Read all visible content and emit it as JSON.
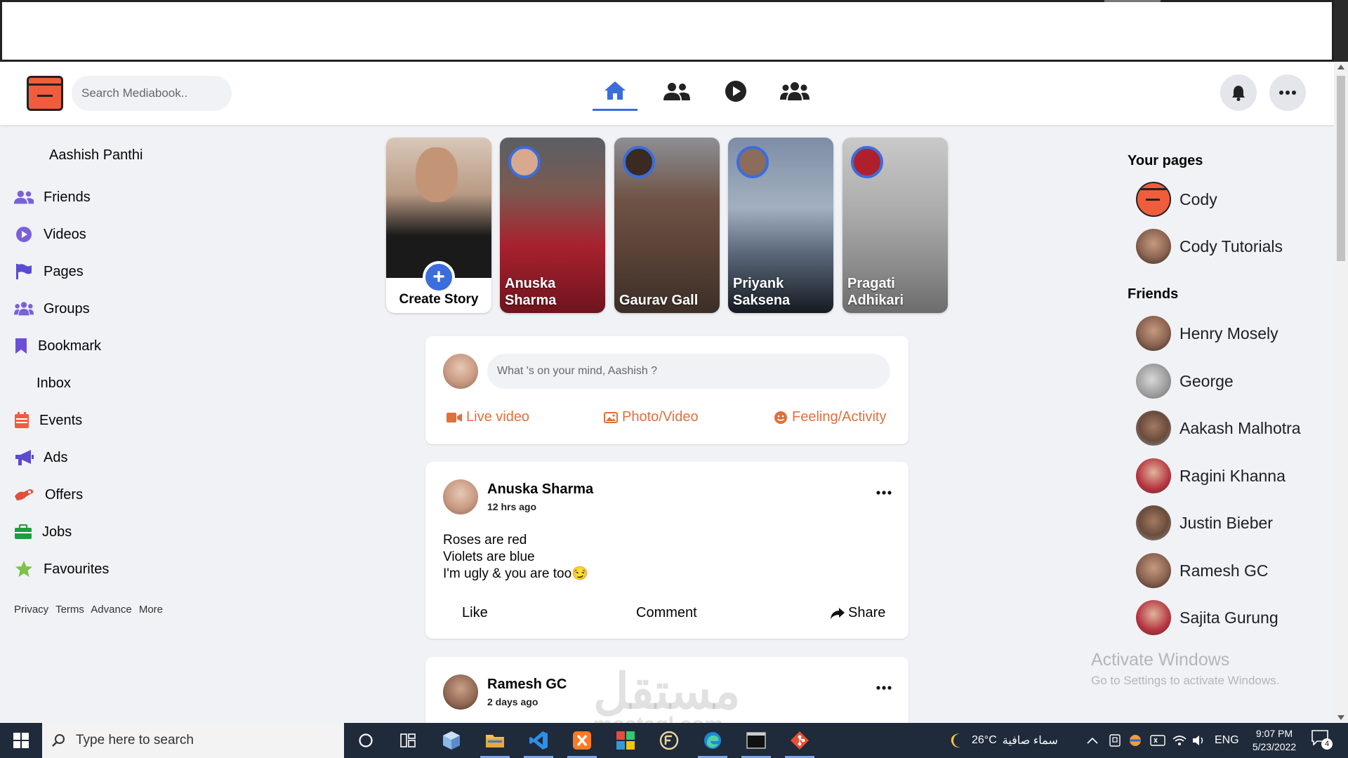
{
  "header": {
    "search_placeholder": "Search Mediabook..",
    "nav": [
      "home-icon",
      "friends-icon",
      "watch-icon",
      "groups-icon"
    ]
  },
  "sidebar": {
    "profile_name": "Aashish Panthi",
    "items": [
      {
        "label": "Friends",
        "icon": "friends-icon",
        "color": "#7b61d8"
      },
      {
        "label": "Videos",
        "icon": "play-icon",
        "color": "#7b61d8"
      },
      {
        "label": "Pages",
        "icon": "flag-icon",
        "color": "#5b4bd0"
      },
      {
        "label": "Groups",
        "icon": "groups-icon",
        "color": "#7b61d8"
      },
      {
        "label": "Bookmark",
        "icon": "bookmark-icon",
        "color": "#6b4fd8"
      },
      {
        "label": "Inbox",
        "icon": "",
        "color": ""
      },
      {
        "label": "Events",
        "icon": "calendar-icon",
        "color": "#f05d3c"
      },
      {
        "label": "Ads",
        "icon": "megaphone-icon",
        "color": "#5b4bd0"
      },
      {
        "label": "Offers",
        "icon": "offer-icon",
        "color": "#e0503c"
      },
      {
        "label": "Jobs",
        "icon": "briefcase-icon",
        "color": "#1e9e3c"
      },
      {
        "label": "Favourites",
        "icon": "star-icon",
        "color": "#7dc24a"
      }
    ],
    "footer_links": [
      "Privacy",
      "Terms",
      "Advance",
      "More"
    ]
  },
  "stories": {
    "create_label": "Create Story",
    "items": [
      {
        "name": "Anuska Sharma",
        "bg": "#8a1f2a"
      },
      {
        "name": "Gaurav Gall",
        "bg": "#6a5a50"
      },
      {
        "name": "Priyank Saksena",
        "bg": "#5e6f86"
      },
      {
        "name": "Pragati Adhikari",
        "bg": "#9a9a9a"
      }
    ]
  },
  "composer": {
    "placeholder": "What 's on your mind, Aashish ?",
    "actions": [
      "Live video",
      "Photo/Video",
      "Feeling/Activity"
    ]
  },
  "posts": [
    {
      "author": "Anuska Sharma",
      "time": "12 hrs ago",
      "lines": [
        "Roses are red",
        "Violets are blue",
        "I'm ugly & you are too😏"
      ],
      "actions": [
        "Like",
        "Comment",
        "Share"
      ]
    },
    {
      "author": "Ramesh GC",
      "time": "2 days ago"
    }
  ],
  "right": {
    "pages_title": "Your pages",
    "pages": [
      "Cody",
      "Cody Tutorials"
    ],
    "friends_title": "Friends",
    "friends": [
      "Henry Mosely",
      "George",
      "Aakash Malhotra",
      "Ragini Khanna",
      "Justin Bieber",
      "Ramesh GC",
      "Sajita Gurung"
    ]
  },
  "watermark": {
    "title": "Activate Windows",
    "subtitle": "Go to Settings to activate Windows.",
    "brand": "مستقل",
    "brand_sub": "mostaql.com"
  },
  "taskbar": {
    "search_placeholder": "Type here to search",
    "weather": "26°C",
    "weather_text": "سماء صافية",
    "lang": "ENG",
    "time": "9:07 PM",
    "date": "5/23/2022",
    "notifications": "4"
  }
}
